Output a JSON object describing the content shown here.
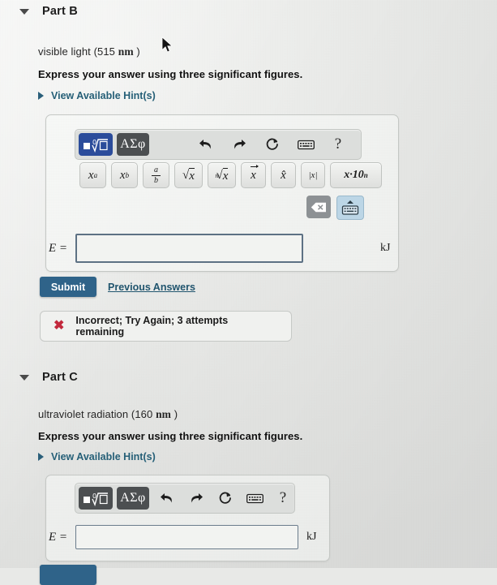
{
  "partB": {
    "title": "Part B",
    "collapse_icon": "triangle-down-icon",
    "prompt_prefix": "visible light (515 ",
    "prompt_unit": "nm",
    "prompt_suffix": " )",
    "instruction": "Express your answer using three significant figures.",
    "hint_label": "View Available Hint(s)",
    "hint_icon": "triangle-right-icon",
    "toolbar": {
      "template_button": "math-template-icon",
      "greek_button": "ΑΣφ",
      "undo": "undo-icon",
      "redo": "redo-icon",
      "reset": "reset-icon",
      "keyboard": "keyboard-icon",
      "help": "?",
      "backspace": "backspace-icon",
      "hide_keyboard": "hide-keyboard-icon"
    },
    "keys": [
      {
        "name": "superscript-key",
        "label": "x^a"
      },
      {
        "name": "subscript-key",
        "label": "x_b"
      },
      {
        "name": "fraction-key",
        "num": "a",
        "den": "b"
      },
      {
        "name": "sqrt-key",
        "label": "√x"
      },
      {
        "name": "nth-root-key",
        "label": "ⁿ√x"
      },
      {
        "name": "vector-key",
        "label": "x"
      },
      {
        "name": "hat-key",
        "label": "x̂"
      },
      {
        "name": "absolute-value-key",
        "label": "|x|"
      },
      {
        "name": "scientific-notation-key",
        "label": "x·10ⁿ"
      }
    ],
    "answer": {
      "label": "E =",
      "value": "",
      "placeholder": "",
      "unit": "kJ"
    },
    "submit_label": "Submit",
    "previous_answers_label": "Previous Answers",
    "feedback": {
      "icon": "x-mark-icon",
      "text": "Incorrect; Try Again; 3 attempts remaining"
    }
  },
  "partC": {
    "title": "Part C",
    "collapse_icon": "triangle-down-icon",
    "prompt_prefix": "ultraviolet radiation (160 ",
    "prompt_unit": "nm",
    "prompt_suffix": " )",
    "instruction": "Express your answer using three significant figures.",
    "hint_label": "View Available Hint(s)",
    "hint_icon": "triangle-right-icon",
    "toolbar": {
      "template_button": "math-template-icon",
      "greek_button": "ΑΣφ",
      "undo": "undo-icon",
      "redo": "redo-icon",
      "reset": "reset-icon",
      "keyboard": "keyboard-icon",
      "help": "?"
    },
    "answer": {
      "label": "E =",
      "value": "",
      "placeholder": "",
      "unit": "kJ"
    }
  },
  "colors": {
    "accent_blue": "#2b4c9b",
    "submit_blue": "#2f6389",
    "link_blue": "#255f77",
    "toolbar_dark": "#4c4f51",
    "error_red": "#c2283c",
    "input_border": "#5d7184"
  }
}
